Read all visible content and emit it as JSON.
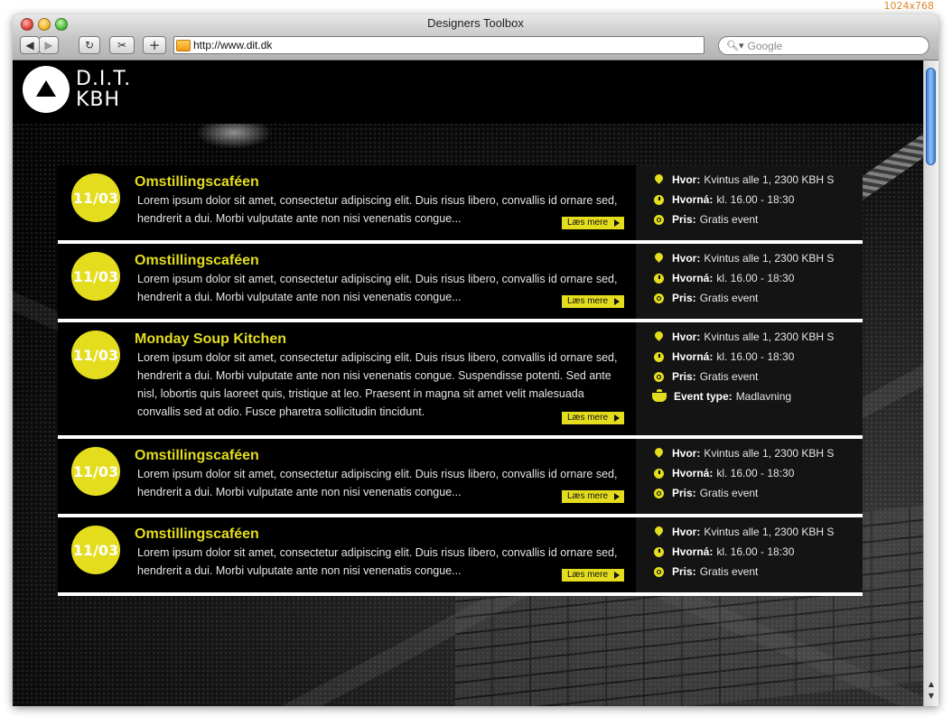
{
  "overlay": {
    "size_label": "1024x768"
  },
  "window": {
    "title": "Designers Toolbox"
  },
  "toolbar": {
    "back_glyph": "◀",
    "forward_glyph": "▶",
    "reload_glyph": "↻",
    "bookmark_glyph": "✂",
    "add_glyph": "+",
    "url": "http://www.dit.dk",
    "search_placeholder": "Google",
    "search_glyph": "🔍︎▾"
  },
  "site": {
    "logo_line1": "D.I.T.",
    "logo_line2": "KBH",
    "accent_color": "#e4dd1e"
  },
  "labels": {
    "where": "Hvor:",
    "when": "Hvorná:",
    "price": "Pris:",
    "event_type": "Event type:",
    "read_more": "Læs mere"
  },
  "events": [
    {
      "date": "11/03",
      "title": "Omstillingscaféen",
      "description": "Lorem ipsum dolor sit amet, consectetur adipiscing elit. Duis risus libero, convallis id ornare sed, hendrerit a dui. Morbi vulputate ante non nisi venenatis congue...",
      "where": "Kvintus alle 1, 2300 KBH S",
      "when": "kl. 16.00 - 18:30",
      "price": "Gratis event"
    },
    {
      "date": "11/03",
      "title": "Omstillingscaféen",
      "description": "Lorem ipsum dolor sit amet, consectetur adipiscing elit. Duis risus libero, convallis id ornare sed, hendrerit a dui. Morbi vulputate ante non nisi venenatis congue...",
      "where": "Kvintus alle 1, 2300 KBH S",
      "when": "kl. 16.00 - 18:30",
      "price": "Gratis event"
    },
    {
      "date": "11/03",
      "title": "Monday Soup Kitchen",
      "description": "Lorem ipsum dolor sit amet, consectetur adipiscing elit. Duis risus libero, convallis id ornare sed, hendrerit a dui. Morbi vulputate ante non nisi venenatis congue. Suspendisse potenti. Sed ante nisl, lobortis quis laoreet quis, tristique at leo. Praesent in magna sit amet velit malesuada convallis sed at odio. Fusce pharetra sollicitudin tincidunt.",
      "where": "Kvintus alle 1, 2300 KBH S",
      "when": "kl. 16.00 - 18:30",
      "price": "Gratis event",
      "event_type": "Madlavning"
    },
    {
      "date": "11/03",
      "title": "Omstillingscaféen",
      "description": "Lorem ipsum dolor sit amet, consectetur adipiscing elit. Duis risus libero, convallis id ornare sed, hendrerit a dui. Morbi vulputate ante non nisi venenatis congue...",
      "where": "Kvintus alle 1, 2300 KBH S",
      "when": "kl. 16.00 - 18:30",
      "price": "Gratis event"
    },
    {
      "date": "11/03",
      "title": "Omstillingscaféen",
      "description": "Lorem ipsum dolor sit amet, consectetur adipiscing elit. Duis risus libero, convallis id ornare sed, hendrerit a dui. Morbi vulputate ante non nisi venenatis congue...",
      "where": "Kvintus alle 1, 2300 KBH S",
      "when": "kl. 16.00 - 18:30",
      "price": "Gratis event"
    }
  ]
}
